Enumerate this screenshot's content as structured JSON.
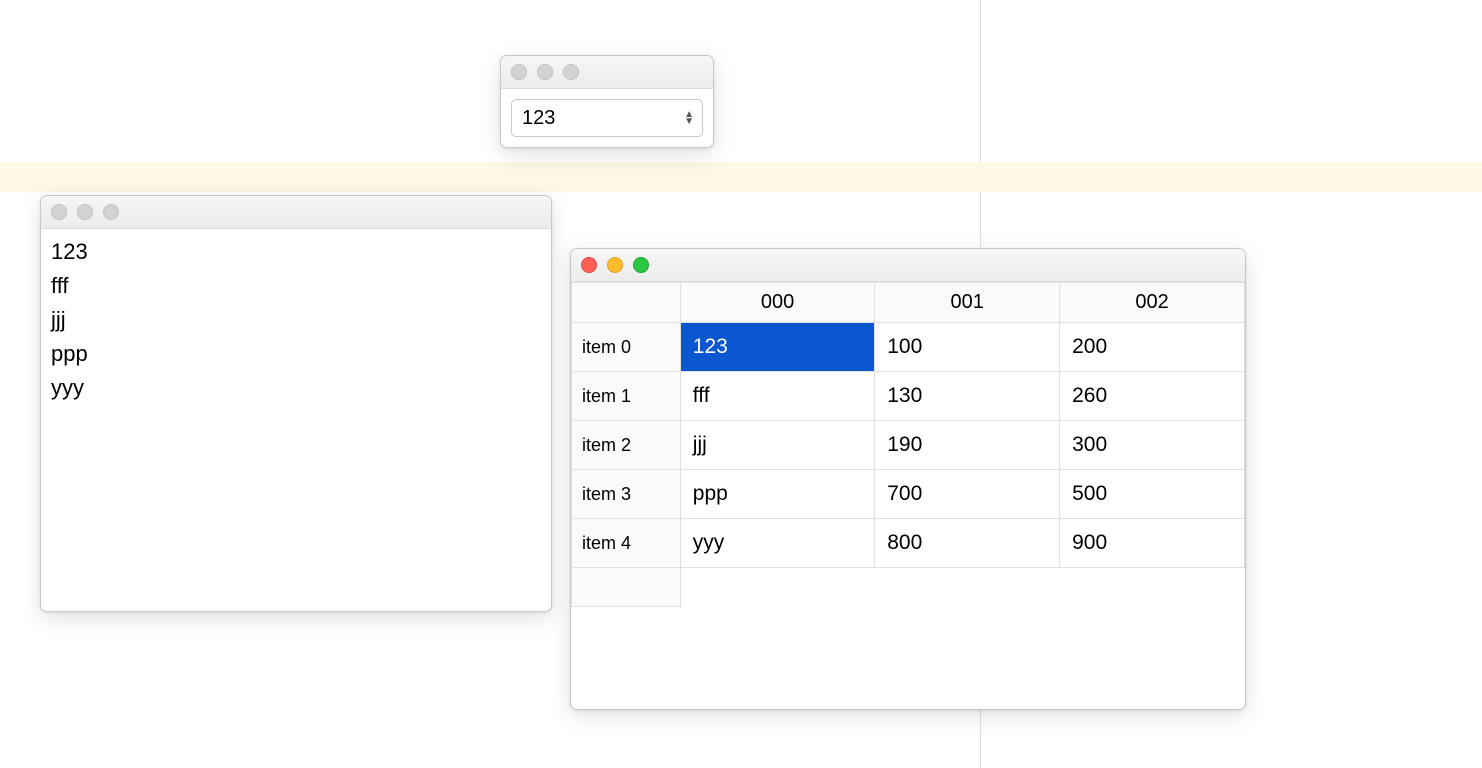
{
  "combo": {
    "value": "123"
  },
  "list": {
    "items": [
      "123",
      "fff",
      "jjj",
      "ppp",
      "yyy"
    ]
  },
  "table": {
    "columns": [
      "000",
      "001",
      "002"
    ],
    "row_headers": [
      "item 0",
      "item 1",
      "item 2",
      "item 3",
      "item 4"
    ],
    "rows": [
      [
        "123",
        "100",
        "200"
      ],
      [
        "fff",
        "130",
        "260"
      ],
      [
        "jjj",
        "190",
        "300"
      ],
      [
        "ppp",
        "700",
        "500"
      ],
      [
        "yyy",
        "800",
        "900"
      ]
    ],
    "selected_cell": {
      "row": 0,
      "col": 0
    }
  }
}
